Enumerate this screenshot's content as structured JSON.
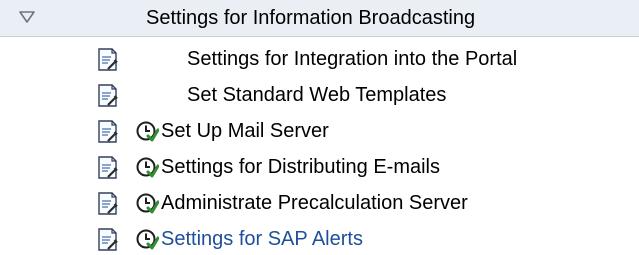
{
  "header": {
    "title": "Settings for Information Broadcasting",
    "toggle_icon": "collapse-triangle-icon"
  },
  "items": [
    {
      "label": "Settings for Integration into the Portal",
      "has_execute_icon": false,
      "link_style": false
    },
    {
      "label": "Set Standard Web Templates",
      "has_execute_icon": false,
      "link_style": false
    },
    {
      "label": "Set Up Mail Server",
      "has_execute_icon": true,
      "link_style": false
    },
    {
      "label": "Settings for Distributing E-mails",
      "has_execute_icon": true,
      "link_style": false
    },
    {
      "label": "Administrate Precalculation Server",
      "has_execute_icon": true,
      "link_style": false
    },
    {
      "label": "Settings for SAP Alerts",
      "has_execute_icon": true,
      "link_style": true
    }
  ],
  "colors": {
    "header_background": "#e9eff5",
    "link_text": "#1e4f9a",
    "icon_green": "#2f8f2f"
  }
}
